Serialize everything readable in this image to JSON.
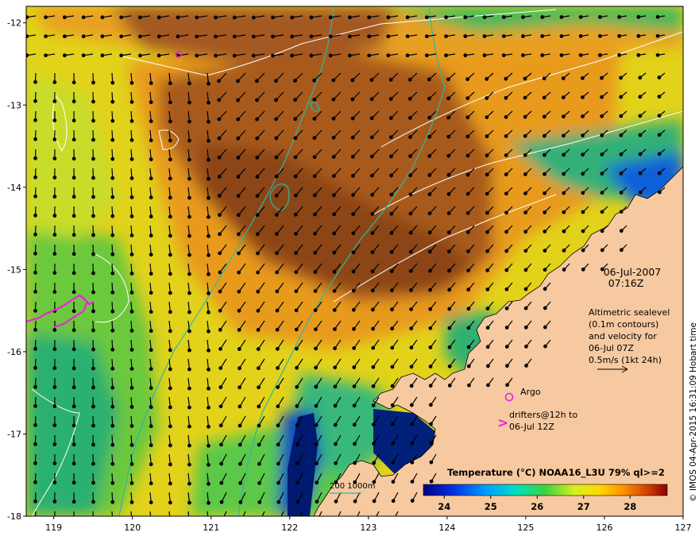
{
  "map": {
    "lat_labels": [
      "-12",
      "-13",
      "-14",
      "-15",
      "-16",
      "-17",
      "-18"
    ],
    "lon_labels": [
      "119",
      "120",
      "121",
      "122",
      "123",
      "124",
      "125",
      "126",
      "127"
    ],
    "lat_range": [
      -18,
      -11.8
    ],
    "lon_range": [
      118.65,
      127.0
    ]
  },
  "annotation": {
    "date": "06-Jul-2007",
    "time": "07:16Z",
    "alt_line1": "Altimetric sealevel",
    "alt_line2": "(0.1m contours)",
    "alt_line3": "and velocity for",
    "alt_line4": "06-Jul 07Z",
    "alt_line5": "0.5m/s (1kt 24h)"
  },
  "legend": {
    "argo_label": "Argo",
    "drifters_line1": "drifters@12h to",
    "drifters_line2": "06-Jul 12Z",
    "depth_label": "200  1000m"
  },
  "colorbar": {
    "title": "Temperature (°C) NOAA16_L3U 79% ql>=2",
    "ticks": [
      "24",
      "25",
      "26",
      "27",
      "28"
    ],
    "colors": [
      "#000080",
      "#0050ff",
      "#00c8ff",
      "#20d070",
      "#b4e63c",
      "#ffff00",
      "#ffb400",
      "#e87800",
      "#b44800",
      "#8c0000"
    ]
  },
  "credit": "© IMOS 04-Apr-2015 16:31:09 Hobart time",
  "colors": {
    "land": "#f7c9a0",
    "warm_brown": "#a85a1e",
    "orange": "#e8961e",
    "yellow": "#f0e628",
    "green": "#3cc85a",
    "deep_blue": "#00186e",
    "isobath": "#2ab8a8",
    "argo_magenta": "#dd22dd"
  }
}
